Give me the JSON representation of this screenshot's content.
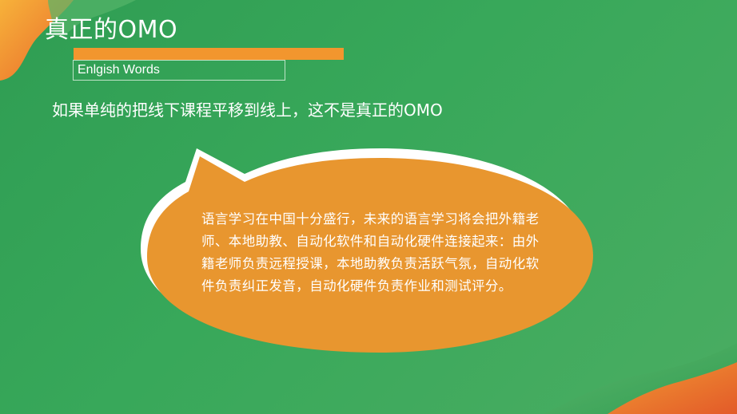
{
  "slide": {
    "title": "真正的OMO",
    "subtitle": "Enlgish Words",
    "lead": "如果单纯的把线下课程平移到线上，这不是真正的OMO",
    "bubble_text": "语言学习在中国十分盛行，未来的语言学习将会把外籍老师、本地助教、自动化软件和自动化硬件连接起来：由外籍老师负责远程授课，本地助教负责活跃气氛，自动化软件负责纠正发音，自动化硬件负责作业和测试评分。"
  },
  "colors": {
    "background_green": "#33a256",
    "accent_orange": "#f2962e",
    "bubble_orange": "#e8962f",
    "text_white": "#ffffff"
  }
}
